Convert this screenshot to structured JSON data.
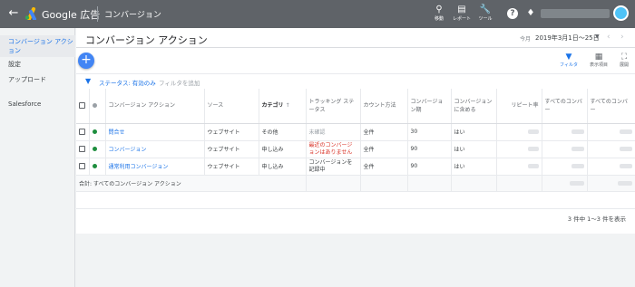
{
  "header": {
    "brand": "Google 広告",
    "page_heading": "コンバージョン",
    "tools": [
      {
        "icon": "search-icon",
        "label": "移動"
      },
      {
        "icon": "reports-icon",
        "label": "レポート"
      },
      {
        "icon": "wrench-icon",
        "label": "ツール"
      }
    ]
  },
  "sidebar": {
    "items": [
      {
        "label": "コンバージョン アクション",
        "active": true
      },
      {
        "label": "設定"
      },
      {
        "label": "アップロード"
      },
      {
        "label": "Salesforce"
      }
    ]
  },
  "main": {
    "title": "コンバージョン アクション",
    "date_label": "今月",
    "date_range": "2019年3月1日〜25日",
    "card_tools": [
      {
        "icon": "filter-icon",
        "label": "フィルタ"
      },
      {
        "icon": "columns-icon",
        "label": "表示項目"
      },
      {
        "icon": "expand-icon",
        "label": "展開"
      }
    ],
    "filter": {
      "status": "ステータス: 有効のみ",
      "add": "フィルタを追加"
    }
  },
  "table": {
    "headers": [
      "コンバージョン アクション",
      "ソース",
      "カテゴリ",
      "トラッキング ステータス",
      "カウント方法",
      "コンバージョン期",
      "コンバージョンに含める",
      "リピート率",
      "すべてのコンバー",
      "すべてのコンバー"
    ],
    "sort_indicator": "↑",
    "rows": [
      {
        "action": "問合せ",
        "source": "ウェブサイト",
        "category": "その他",
        "tracking": "未確認",
        "count": "全件",
        "window": "30",
        "include": "はい",
        "status_color": "#1e8e3e"
      },
      {
        "action": "コンバージョン",
        "source": "ウェブサイト",
        "category": "申し込み",
        "tracking": "最近のコンバージョンはありません",
        "count": "全件",
        "window": "90",
        "include": "はい",
        "status_color": "#1e8e3e"
      },
      {
        "action": "通常利用コンバージョン",
        "source": "ウェブサイト",
        "category": "申し込み",
        "tracking": "コンバージョンを記録中",
        "count": "全件",
        "window": "90",
        "include": "はい",
        "status_color": "#1e8e3e"
      }
    ],
    "total_label": "合計: すべてのコンバージョン アクション"
  },
  "footer": {
    "pager": "3 件中 1～3 件を表示"
  },
  "colors": {
    "topbar": "#5f6368",
    "accent": "#1a73e8",
    "fab": "#4285f4",
    "active_dot": "#1e8e3e",
    "warning_text": "#d93025"
  }
}
